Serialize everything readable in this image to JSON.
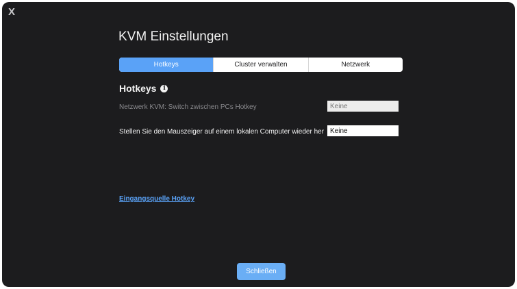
{
  "window": {
    "close_glyph": "X",
    "title": "KVM Einstellungen"
  },
  "tabs": [
    {
      "label": "Hotkeys",
      "active": true
    },
    {
      "label": "Cluster verwalten",
      "active": false
    },
    {
      "label": "Netzwerk",
      "active": false
    }
  ],
  "section": {
    "heading": "Hotkeys",
    "info_icon": "info-icon"
  },
  "rows": [
    {
      "label": "Netzwerk KVM: Switch zwischen PCs Hotkey",
      "value": "Keine",
      "enabled": false
    },
    {
      "label": "Stellen Sie den Mauszeiger auf einem lokalen Computer wieder her",
      "value": "Keine",
      "enabled": true
    }
  ],
  "link": {
    "label": "Eingangsquelle Hotkey"
  },
  "footer": {
    "close_label": "Schließen"
  },
  "colors": {
    "background": "#1c1c1e",
    "accent": "#5aa2f7",
    "text": "#f2f2f2",
    "muted_text": "#8a8a8e"
  }
}
